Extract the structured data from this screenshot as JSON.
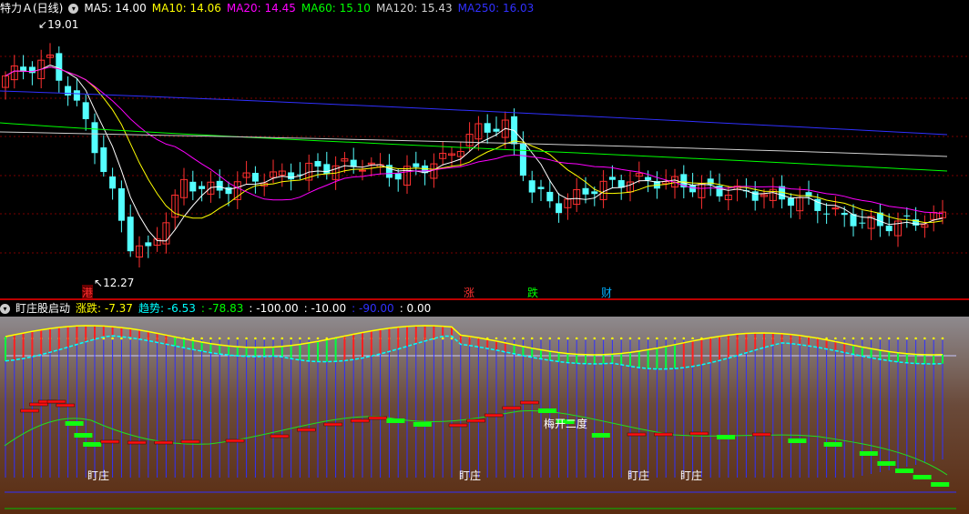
{
  "main": {
    "stock_name": "特力Ａ(日线)",
    "ma": [
      {
        "label": "MA5: ",
        "value": "14.00",
        "color": "#ffffff"
      },
      {
        "label": "MA10: ",
        "value": "14.06",
        "color": "#ffff00"
      },
      {
        "label": "MA20: ",
        "value": "14.45",
        "color": "#ff00ff"
      },
      {
        "label": "MA60: ",
        "value": "15.10",
        "color": "#00ff00"
      },
      {
        "label": "MA120: ",
        "value": "15.43",
        "color": "#d0d0d0"
      },
      {
        "label": "MA250: ",
        "value": "16.03",
        "color": "#3030ff"
      }
    ],
    "high_label": "19.01",
    "low_label": "12.27",
    "markers": [
      {
        "text": "港",
        "color": "#ff3030",
        "bg": "#600"
      },
      {
        "text": "涨",
        "color": "#ff3030",
        "bg": ""
      },
      {
        "text": "跌",
        "color": "#00ff00",
        "bg": ""
      },
      {
        "text": "财",
        "color": "#00b0ff",
        "bg": ""
      }
    ],
    "colors": {
      "up": "#ff3030",
      "down": "#54ffff",
      "grid": "#7a0000"
    }
  },
  "sub": {
    "indicator_name": "盯庄股启动",
    "values": [
      {
        "label": "涨跌: ",
        "value": "-7.37",
        "color": "#ffff00"
      },
      {
        "label": "趋势: ",
        "value": "-6.53",
        "color": "#00ffff"
      },
      {
        "label": ": ",
        "value": "-78.83",
        "color": "#00ff00"
      },
      {
        "label": ": ",
        "value": "-100.00",
        "color": "#ffffff"
      },
      {
        "label": ": ",
        "value": "-10.00",
        "color": "#ffffff"
      },
      {
        "label": ": ",
        "value": "-90.00",
        "color": "#3030ff"
      },
      {
        "label": ": ",
        "value": "0.00",
        "color": "#ffffff"
      }
    ],
    "annotations": [
      "盯庄",
      "盯庄",
      "盯庄",
      "盯庄",
      "梅开二度"
    ]
  }
}
